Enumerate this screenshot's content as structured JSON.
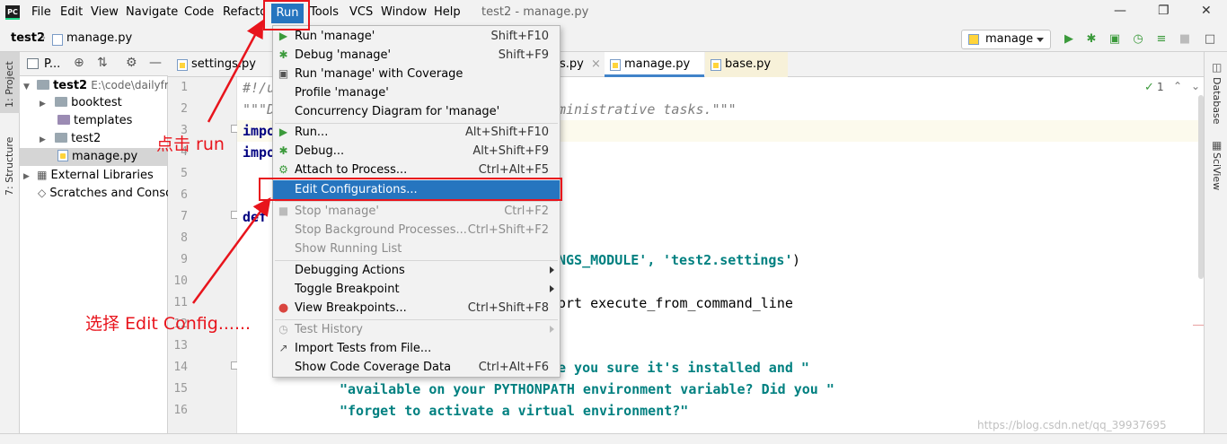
{
  "menubar": {
    "items": [
      "File",
      "Edit",
      "View",
      "Navigate",
      "Code",
      "Refactor",
      "Run",
      "Tools",
      "VCS",
      "Window",
      "Help"
    ],
    "title": "test2 - manage.py",
    "logo": "PC"
  },
  "navbar": {
    "breadcrumb_project": "test2",
    "breadcrumb_file": "manage.py",
    "run_config": "manage"
  },
  "left_tools": {
    "project": "1: Project",
    "structure": "7: Structure"
  },
  "right_tools": {
    "database": "Database",
    "sciview": "SciView"
  },
  "project_panel": {
    "header": "P...",
    "tree": [
      {
        "name": "test2",
        "detail": "E:\\code\\dailyfr"
      },
      {
        "name": "booktest"
      },
      {
        "name": "templates"
      },
      {
        "name": "test2"
      },
      {
        "name": "manage.py"
      },
      {
        "name": "External Libraries"
      },
      {
        "name": "Scratches and Conso"
      }
    ]
  },
  "tabs": [
    "settings.py",
    "s.py",
    "manage.py",
    "base.py"
  ],
  "editor": {
    "line_numbers": [
      "1",
      "2",
      "3",
      "4",
      "5",
      "6",
      "7",
      "8",
      "9",
      "10",
      "11",
      "12",
      "13",
      "14",
      "15",
      "16"
    ],
    "inspection_count": "1",
    "lines": {
      "l1": "#!/u",
      "l2a": "\"\"\"D",
      "l2b": "ministrative tasks.\"\"\"",
      "l3": "impo",
      "l4": "impo",
      "l7": "def",
      "l9a": "NGS_MODULE', ",
      "l9b": "'test2.settings'",
      "l9c": ")",
      "l11": "ort execute_from_command_line",
      "l14": "e you sure it's installed and \"",
      "l15": "\"available on your PYTHONPATH environment variable? Did you \"",
      "l16": "\"forget to activate a virtual environment?\""
    }
  },
  "run_menu": {
    "items": [
      {
        "label": "Run 'manage'",
        "shortcut": "Shift+F10",
        "icon": "run-icon",
        "state": "normal"
      },
      {
        "label": "Debug 'manage'",
        "shortcut": "Shift+F9",
        "icon": "debug-icon",
        "state": "normal"
      },
      {
        "label": "Run 'manage' with Coverage",
        "shortcut": "",
        "icon": "coverage-icon",
        "state": "normal"
      },
      {
        "label": "Profile 'manage'",
        "shortcut": "",
        "icon": "",
        "state": "normal"
      },
      {
        "label": "Concurrency Diagram for 'manage'",
        "shortcut": "",
        "icon": "",
        "state": "normal"
      },
      {
        "label": "Run...",
        "shortcut": "Alt+Shift+F10",
        "icon": "run-icon",
        "state": "normal"
      },
      {
        "label": "Debug...",
        "shortcut": "Alt+Shift+F9",
        "icon": "debug-icon",
        "state": "normal"
      },
      {
        "label": "Attach to Process...",
        "shortcut": "Ctrl+Alt+F5",
        "icon": "attach-icon",
        "state": "normal"
      },
      {
        "label": "Edit Configurations...",
        "shortcut": "",
        "icon": "",
        "state": "selected"
      },
      {
        "label": "Stop 'manage'",
        "shortcut": "Ctrl+F2",
        "icon": "stop-icon",
        "state": "disabled"
      },
      {
        "label": "Stop Background Processes...",
        "shortcut": "Ctrl+Shift+F2",
        "icon": "",
        "state": "disabled"
      },
      {
        "label": "Show Running List",
        "shortcut": "",
        "icon": "",
        "state": "disabled"
      },
      {
        "label": "Debugging Actions",
        "shortcut": "",
        "icon": "",
        "state": "submenu"
      },
      {
        "label": "Toggle Breakpoint",
        "shortcut": "",
        "icon": "",
        "state": "submenu"
      },
      {
        "label": "View Breakpoints...",
        "shortcut": "Ctrl+Shift+F8",
        "icon": "breakpoint-icon",
        "state": "normal"
      },
      {
        "label": "Test History",
        "shortcut": "",
        "icon": "history-icon",
        "state": "disabled-submenu"
      },
      {
        "label": "Import Tests from File...",
        "shortcut": "",
        "icon": "import-icon",
        "state": "normal"
      },
      {
        "label": "Show Code Coverage Data",
        "shortcut": "Ctrl+Alt+F6",
        "icon": "",
        "state": "normal"
      }
    ]
  },
  "annotations": {
    "click_run": "点击 run",
    "select_edit": "选择 Edit Config......"
  },
  "watermark": "https://blog.csdn.net/qq_39937695",
  "colors": {
    "highlight": "#e8141c",
    "selection": "#2675bf"
  }
}
